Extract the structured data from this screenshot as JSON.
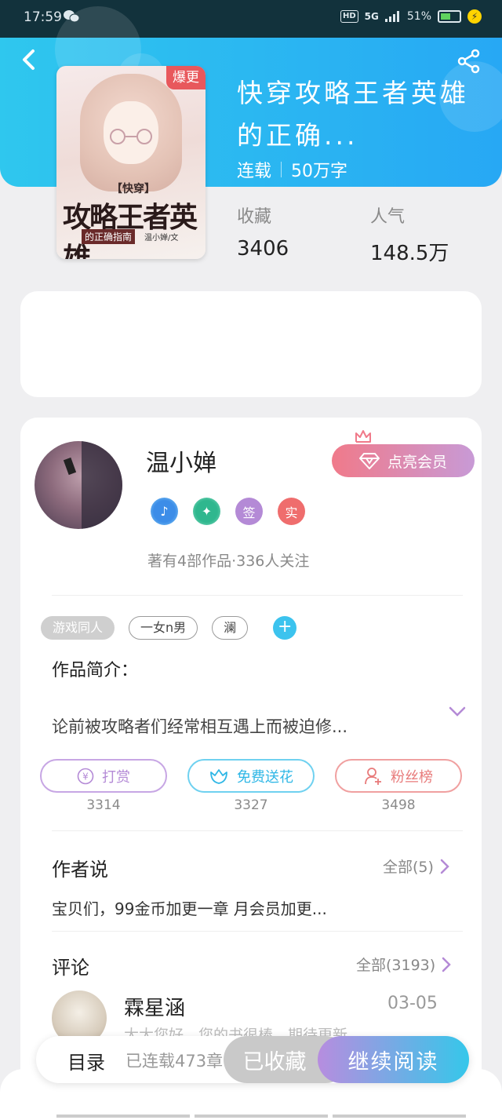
{
  "status_bar": {
    "time": "17:59",
    "battery_percent": "51%",
    "network": "5G",
    "hd": "HD"
  },
  "book": {
    "title": "快穿攻略王者英雄的正确...",
    "status": "连载",
    "word_count": "50万字",
    "cover": {
      "tag": "爆更",
      "line1": "【快穿】",
      "line2": "攻略王者英雄",
      "line3": "的正确指南",
      "author": "温小婵/文"
    },
    "stats": [
      {
        "label": "收藏",
        "value": "3406"
      },
      {
        "label": "人气",
        "value": "148.5万"
      }
    ]
  },
  "author": {
    "name": "温小婵",
    "vip_button": "点亮会员",
    "badges": [
      "♪",
      "✦",
      "签",
      "实"
    ],
    "follow_info": "著有4部作品·336人关注"
  },
  "tags": [
    "游戏同人",
    "一女n男",
    "澜"
  ],
  "intro": {
    "heading": "作品简介：",
    "text": "论前被攻略者们经常相互遇上而被迫修..."
  },
  "actions": [
    {
      "label": "打赏",
      "count": "3314",
      "icon": "yen-icon",
      "color": "#b48ad6"
    },
    {
      "label": "免费送花",
      "count": "3327",
      "icon": "flower-icon",
      "color": "#3cc3ee"
    },
    {
      "label": "粉丝榜",
      "count": "3498",
      "icon": "fans-icon",
      "color": "#e87b7b"
    }
  ],
  "author_says": {
    "heading": "作者说",
    "more": "全部(5)",
    "text": "宝贝们，99金币加更一章 月会员加更..."
  },
  "comments": {
    "heading": "评论",
    "more": "全部(3193)",
    "items": [
      {
        "user": "霖星涵",
        "date": "03-05",
        "text": "大大您好，您的书很棒，期待更新..."
      }
    ]
  },
  "bottom_bar": {
    "toc": "目录",
    "progress": "已连载473章",
    "favorited": "已收藏",
    "continue": "继续阅读"
  },
  "colors": {
    "header_start": "#2fc7ee",
    "header_end": "#27a8f4",
    "accent_purple": "#b78ddf",
    "accent_blue": "#35c7ea"
  }
}
